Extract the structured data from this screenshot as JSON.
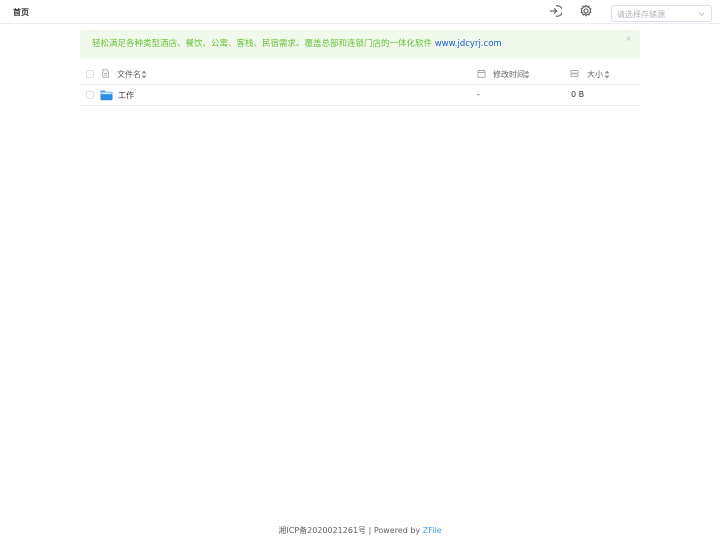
{
  "header": {
    "breadcrumb": "首页",
    "storage_select": {
      "placeholder": "请选择存储源"
    },
    "icons": {
      "logout": "logout-icon",
      "settings": "gear-icon",
      "dropdown": "chevron-down-icon"
    }
  },
  "alert": {
    "text": "轻松满足各种类型酒店、餐饮、公寓、客栈、民宿需求。覆盖总部和连锁门店的一体化软件",
    "link_text": "www.jdcyrj.com",
    "close_glyph": "×",
    "colors": {
      "background": "#f0f9eb",
      "text": "#67c23a",
      "link": "#1a5fd4"
    }
  },
  "table": {
    "columns": [
      {
        "label": "文件名",
        "icon": "document-icon"
      },
      {
        "label": "修改时间",
        "icon": "calendar-icon"
      },
      {
        "label": "大小",
        "icon": "storage-icon"
      }
    ],
    "rows": [
      {
        "name": "工作",
        "type_icon": "folder-icon",
        "modified": "-",
        "size": "0 B"
      }
    ]
  },
  "footer": {
    "icp": "湘ICP备2020021261号",
    "separator": " | ",
    "powered_prefix": "Powered by ",
    "powered_link": "ZFile"
  }
}
